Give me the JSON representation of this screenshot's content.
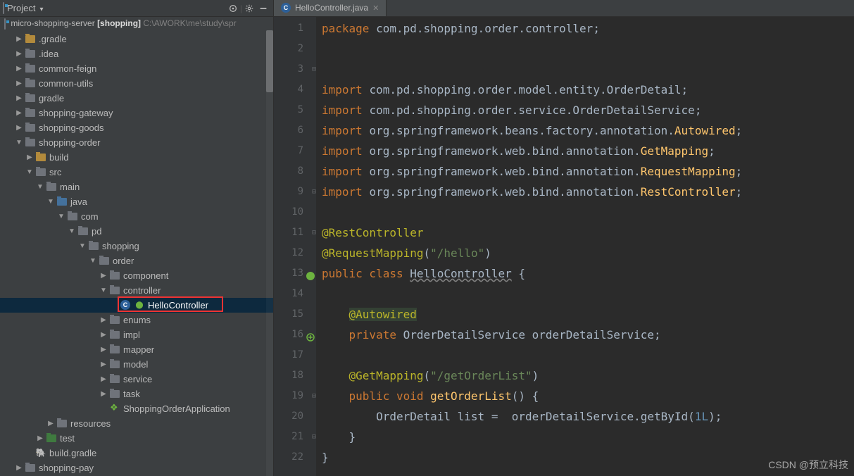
{
  "sidebar": {
    "title": "Project",
    "icons": [
      "target",
      "gear",
      "hide"
    ],
    "project_name": "micro-shopping-server",
    "project_context": "[shopping]",
    "project_path": "C:\\AWORK\\me\\study\\spr"
  },
  "tree": [
    {
      "ind": 1,
      "exp": "▶",
      "ic": "folder-yellow",
      "lbl": ".gradle"
    },
    {
      "ind": 1,
      "exp": "▶",
      "ic": "folder-gray",
      "lbl": ".idea"
    },
    {
      "ind": 1,
      "exp": "▶",
      "ic": "folder-gray",
      "lbl": "common-feign"
    },
    {
      "ind": 1,
      "exp": "▶",
      "ic": "folder-gray",
      "lbl": "common-utils"
    },
    {
      "ind": 1,
      "exp": "▶",
      "ic": "folder-gray",
      "lbl": "gradle"
    },
    {
      "ind": 1,
      "exp": "▶",
      "ic": "folder-gray",
      "lbl": "shopping-gateway"
    },
    {
      "ind": 1,
      "exp": "▶",
      "ic": "folder-gray",
      "lbl": "shopping-goods"
    },
    {
      "ind": 1,
      "exp": "▼",
      "ic": "folder-gray",
      "lbl": "shopping-order"
    },
    {
      "ind": 2,
      "exp": "▶",
      "ic": "folder-yellow",
      "lbl": "build"
    },
    {
      "ind": 2,
      "exp": "▼",
      "ic": "folder-gray",
      "lbl": "src"
    },
    {
      "ind": 3,
      "exp": "▼",
      "ic": "folder-gray",
      "lbl": "main"
    },
    {
      "ind": 4,
      "exp": "▼",
      "ic": "folder-blue",
      "lbl": "java"
    },
    {
      "ind": 5,
      "exp": "▼",
      "ic": "folder-gray",
      "lbl": "com"
    },
    {
      "ind": 6,
      "exp": "▼",
      "ic": "folder-gray",
      "lbl": "pd"
    },
    {
      "ind": 7,
      "exp": "▼",
      "ic": "folder-gray",
      "lbl": "shopping"
    },
    {
      "ind": 8,
      "exp": "▼",
      "ic": "folder-gray",
      "lbl": "order"
    },
    {
      "ind": 9,
      "exp": "▶",
      "ic": "folder-gray",
      "lbl": "component"
    },
    {
      "ind": 9,
      "exp": "▼",
      "ic": "folder-gray",
      "lbl": "controller"
    },
    {
      "ind": 10,
      "exp": "",
      "ic": "class-icon",
      "lbl": "HelloController",
      "sel": true,
      "spring": true
    },
    {
      "ind": 9,
      "exp": "▶",
      "ic": "folder-gray",
      "lbl": "enums"
    },
    {
      "ind": 9,
      "exp": "▶",
      "ic": "folder-gray",
      "lbl": "impl"
    },
    {
      "ind": 9,
      "exp": "▶",
      "ic": "folder-gray",
      "lbl": "mapper"
    },
    {
      "ind": 9,
      "exp": "▶",
      "ic": "folder-gray",
      "lbl": "model"
    },
    {
      "ind": 9,
      "exp": "▶",
      "ic": "folder-gray",
      "lbl": "service"
    },
    {
      "ind": 9,
      "exp": "▶",
      "ic": "folder-gray",
      "lbl": "task"
    },
    {
      "ind": 9,
      "exp": "",
      "ic": "spring-icon",
      "lbl": "ShoppingOrderApplication"
    },
    {
      "ind": 4,
      "exp": "▶",
      "ic": "folder-gray",
      "lbl": "resources"
    },
    {
      "ind": 3,
      "exp": "▶",
      "ic": "folder-green",
      "lbl": "test"
    },
    {
      "ind": 2,
      "exp": "",
      "ic": "elephant",
      "lbl": "build.gradle"
    },
    {
      "ind": 1,
      "exp": "▶",
      "ic": "folder-gray",
      "lbl": "shopping-pay"
    }
  ],
  "highlight_row": 18,
  "tab": {
    "file": "HelloController.java"
  },
  "code": {
    "lines": [
      {
        "n": 1,
        "segs": [
          {
            "t": "package ",
            "c": "k"
          },
          {
            "t": "com.pd.shopping.order.controller;"
          }
        ]
      },
      {
        "n": 2,
        "segs": []
      },
      {
        "n": 3,
        "segs": [],
        "foldOpen": true
      },
      {
        "n": 4,
        "segs": [
          {
            "t": "import ",
            "c": "k"
          },
          {
            "t": "com.pd.shopping.order.model.entity.OrderDetail;"
          }
        ]
      },
      {
        "n": 5,
        "segs": [
          {
            "t": "import ",
            "c": "k"
          },
          {
            "t": "com.pd.shopping.order.service.OrderDetailService;"
          }
        ]
      },
      {
        "n": 6,
        "segs": [
          {
            "t": "import ",
            "c": "k"
          },
          {
            "t": "org.springframework.beans.factory.annotation."
          },
          {
            "t": "Autowired",
            "c": "fn"
          },
          {
            "t": ";"
          }
        ]
      },
      {
        "n": 7,
        "segs": [
          {
            "t": "import ",
            "c": "k"
          },
          {
            "t": "org.springframework.web.bind.annotation."
          },
          {
            "t": "GetMapping",
            "c": "fn"
          },
          {
            "t": ";"
          }
        ]
      },
      {
        "n": 8,
        "segs": [
          {
            "t": "import ",
            "c": "k"
          },
          {
            "t": "org.springframework.web.bind.annotation."
          },
          {
            "t": "RequestMapping",
            "c": "fn"
          },
          {
            "t": ";"
          }
        ]
      },
      {
        "n": 9,
        "segs": [
          {
            "t": "import ",
            "c": "k"
          },
          {
            "t": "org.springframework.web.bind.annotation."
          },
          {
            "t": "RestController",
            "c": "fn"
          },
          {
            "t": ";"
          }
        ],
        "foldClose": true
      },
      {
        "n": 10,
        "segs": []
      },
      {
        "n": 11,
        "segs": [
          {
            "t": "@RestController",
            "c": "an"
          }
        ],
        "foldOpen": true
      },
      {
        "n": 12,
        "segs": [
          {
            "t": "@RequestMapping",
            "c": "an"
          },
          {
            "t": "("
          },
          {
            "t": "\"/hello\"",
            "c": "s"
          },
          {
            "t": ")"
          }
        ]
      },
      {
        "n": 13,
        "segs": [
          {
            "t": "public class ",
            "c": "k"
          },
          {
            "t": "HelloController",
            "c": "wavy"
          },
          {
            "t": " {"
          }
        ],
        "gm": "spring"
      },
      {
        "n": 14,
        "segs": []
      },
      {
        "n": 15,
        "segs": [
          {
            "t": "    "
          },
          {
            "t": "@Autowired",
            "c": "an bg-ann"
          }
        ]
      },
      {
        "n": 16,
        "segs": [
          {
            "t": "    "
          },
          {
            "t": "private ",
            "c": "k"
          },
          {
            "t": "OrderDetailService orderDetailService;"
          }
        ],
        "gm": "bean"
      },
      {
        "n": 17,
        "segs": []
      },
      {
        "n": 18,
        "segs": [
          {
            "t": "    "
          },
          {
            "t": "@GetMapping",
            "c": "an"
          },
          {
            "t": "("
          },
          {
            "t": "\"/getOrderList\"",
            "c": "s"
          },
          {
            "t": ")"
          }
        ]
      },
      {
        "n": 19,
        "segs": [
          {
            "t": "    "
          },
          {
            "t": "public void ",
            "c": "k"
          },
          {
            "t": "getOrderList",
            "c": "fn"
          },
          {
            "t": "() {"
          }
        ],
        "foldOpen": true
      },
      {
        "n": 20,
        "segs": [
          {
            "t": "        OrderDetail list =  orderDetailService.getById("
          },
          {
            "t": "1L",
            "c": "num"
          },
          {
            "t": ");"
          }
        ]
      },
      {
        "n": 21,
        "segs": [
          {
            "t": "    }"
          }
        ],
        "foldClose": true
      },
      {
        "n": 22,
        "segs": [
          {
            "t": "}"
          }
        ]
      }
    ]
  },
  "watermark": "CSDN @预立科技"
}
